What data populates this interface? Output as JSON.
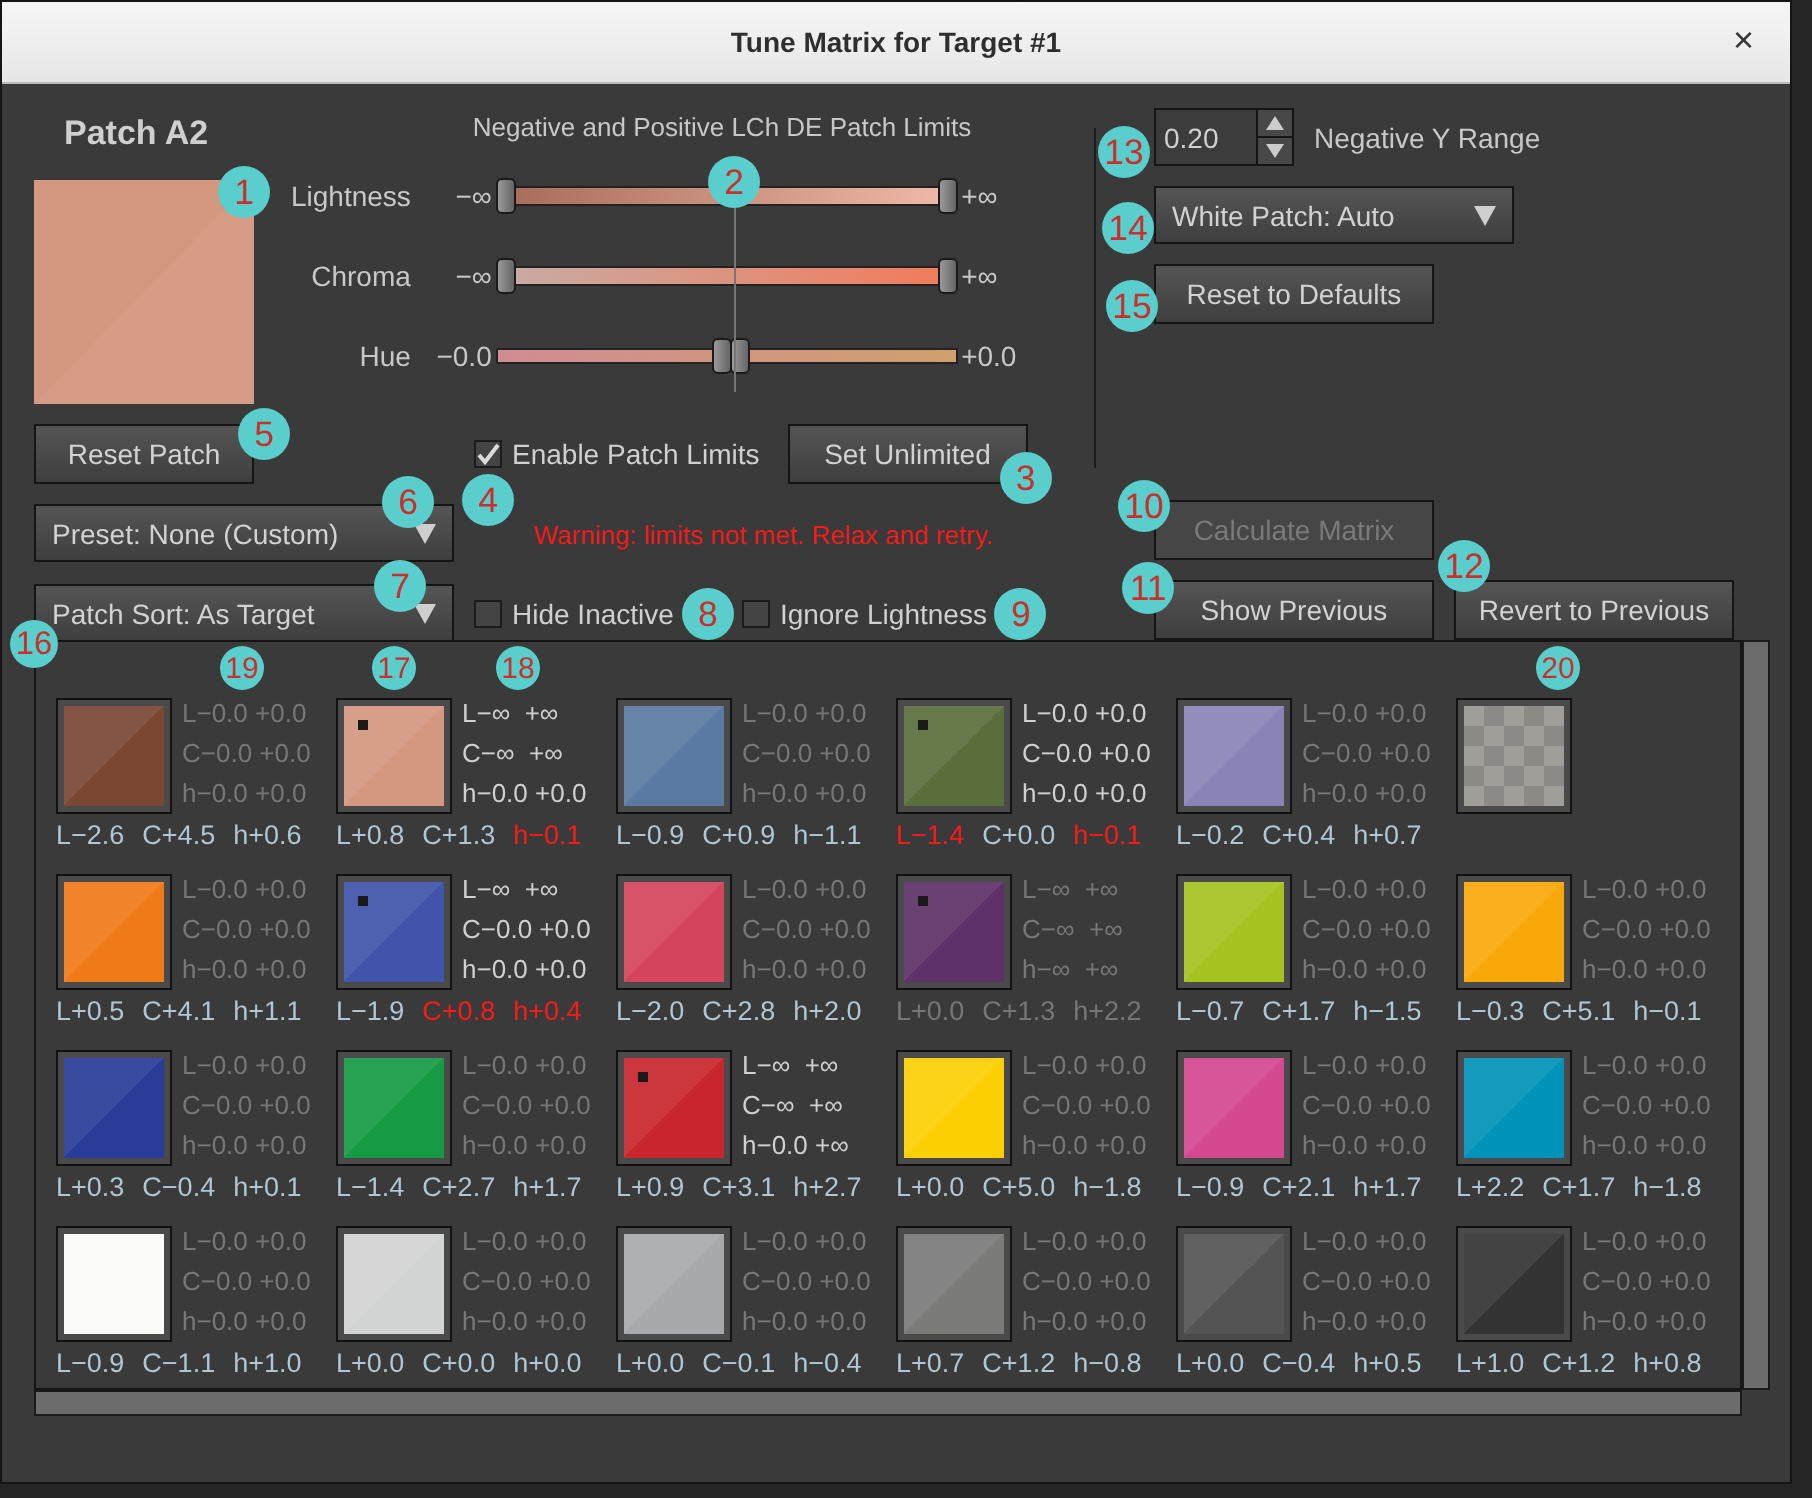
{
  "window": {
    "title": "Tune Matrix for Target #1",
    "close": "×"
  },
  "patch": {
    "title": "Patch A2",
    "color": "#d4977f",
    "callout": "1"
  },
  "limits_title": "Negative and Positive LCh DE Patch Limits",
  "sliders": {
    "callout": "2",
    "rows": [
      {
        "label": "Lightness",
        "kind": "lightness",
        "neg": "−∞",
        "pos": "+∞",
        "thumbs": [
          {
            "level": 0
          },
          {
            "level": 1
          }
        ]
      },
      {
        "label": "Chroma",
        "kind": "chroma",
        "neg": "−∞",
        "pos": "+∞",
        "thumbs": [
          {
            "level": 0
          },
          {
            "level": 1
          }
        ]
      },
      {
        "label": "Hue",
        "kind": "hue",
        "neg": "−0.0",
        "pos": "+0.0",
        "thumbs": [
          {
            "level": 0.49
          },
          {
            "level": 0.53
          }
        ]
      }
    ]
  },
  "reset_patch": {
    "label": "Reset Patch",
    "callout": "5"
  },
  "enable_limits": {
    "label": "Enable Patch Limits",
    "checked": true,
    "callout": "4"
  },
  "set_unlimited": {
    "label": "Set Unlimited",
    "callout": "3"
  },
  "preset": {
    "value": "Preset: None (Custom)",
    "callout": "6"
  },
  "warning": "Warning: limits not met. Relax and retry.",
  "patch_sort": {
    "value": "Patch Sort: As Target",
    "callout": "7"
  },
  "hide_inactive": {
    "label": "Hide Inactive",
    "checked": false,
    "callout": "8"
  },
  "ignore_lightness": {
    "label": "Ignore Lightness",
    "checked": false,
    "callout": "9"
  },
  "negative_y": {
    "value": "0.20",
    "label": "Negative Y Range",
    "callout": "13"
  },
  "white_patch": {
    "value": "White Patch: Auto",
    "callout": "14"
  },
  "reset_defaults": {
    "label": "Reset to Defaults",
    "callout": "15"
  },
  "calculate": {
    "label": "Calculate Matrix",
    "disabled": true,
    "callout": "10"
  },
  "show_previous": {
    "label": "Show Previous",
    "disabled": false,
    "callout": "11"
  },
  "revert": {
    "label": "Revert to Previous",
    "disabled": false,
    "callout": "12"
  },
  "patch_grid": {
    "callout": "16",
    "patches": [
      {
        "kind": "color",
        "color": "#7a4733",
        "marked": false,
        "limits_active": false,
        "inactive": false,
        "limits": [
          "L−0.0 +0.0",
          "C−0.0 +0.0",
          "h−0.0 +0.0"
        ],
        "values": [
          {
            "text": "L−2.6",
            "warn": false
          },
          {
            "text": "C+4.5",
            "warn": false
          },
          {
            "text": "h+0.6",
            "warn": false
          }
        ],
        "values_callout": "19"
      },
      {
        "kind": "color",
        "color": "#d4977f",
        "marked": true,
        "limits_active": true,
        "inactive": false,
        "limits": [
          "L−∞  +∞",
          "C−∞  +∞",
          "h−0.0 +0.0"
        ],
        "values": [
          {
            "text": "L+0.8",
            "warn": false
          },
          {
            "text": "C+1.3",
            "warn": false
          },
          {
            "text": "h−0.1",
            "warn": true
          }
        ],
        "swatch_callout": "17",
        "limits_callout": "18"
      },
      {
        "kind": "color",
        "color": "#5a79a3",
        "marked": false,
        "limits_active": false,
        "inactive": false,
        "limits": [
          "L−0.0 +0.0",
          "C−0.0 +0.0",
          "h−0.0 +0.0"
        ],
        "values": [
          {
            "text": "L−0.9",
            "warn": false
          },
          {
            "text": "C+0.9",
            "warn": false
          },
          {
            "text": "h−1.1",
            "warn": false
          }
        ]
      },
      {
        "kind": "color",
        "color": "#5a6e3c",
        "marked": true,
        "limits_active": true,
        "inactive": false,
        "limits": [
          "L−0.0 +0.0",
          "C−0.0 +0.0",
          "h−0.0 +0.0"
        ],
        "values": [
          {
            "text": "L−1.4",
            "warn": true
          },
          {
            "text": "C+0.0",
            "warn": false
          },
          {
            "text": "h−0.1",
            "warn": true
          }
        ]
      },
      {
        "kind": "color",
        "color": "#8a83b8",
        "marked": false,
        "limits_active": false,
        "inactive": false,
        "limits": [
          "L−0.0 +0.0",
          "C−0.0 +0.0",
          "h−0.0 +0.0"
        ],
        "values": [
          {
            "text": "L−0.2",
            "warn": false
          },
          {
            "text": "C+0.4",
            "warn": false
          },
          {
            "text": "h+0.7",
            "warn": false
          }
        ]
      },
      {
        "kind": "checker",
        "swatch_callout": "20"
      },
      {
        "kind": "color",
        "color": "#f07a18",
        "marked": false,
        "limits_active": false,
        "inactive": false,
        "limits": [
          "L−0.0 +0.0",
          "C−0.0 +0.0",
          "h−0.0 +0.0"
        ],
        "values": [
          {
            "text": "L+0.5",
            "warn": false
          },
          {
            "text": "C+4.1",
            "warn": false
          },
          {
            "text": "h+1.1",
            "warn": false
          }
        ]
      },
      {
        "kind": "color",
        "color": "#3f54aa",
        "marked": true,
        "limits_active": true,
        "inactive": false,
        "limits": [
          "L−∞  +∞",
          "C−0.0 +0.0",
          "h−0.0 +0.0"
        ],
        "values": [
          {
            "text": "L−1.9",
            "warn": false
          },
          {
            "text": "C+0.8",
            "warn": true
          },
          {
            "text": "h+0.4",
            "warn": true
          }
        ]
      },
      {
        "kind": "color",
        "color": "#d4445a",
        "marked": false,
        "limits_active": false,
        "inactive": false,
        "limits": [
          "L−0.0 +0.0",
          "C−0.0 +0.0",
          "h−0.0 +0.0"
        ],
        "values": [
          {
            "text": "L−2.0",
            "warn": false
          },
          {
            "text": "C+2.8",
            "warn": false
          },
          {
            "text": "h+2.0",
            "warn": false
          }
        ]
      },
      {
        "kind": "color",
        "color": "#5e3168",
        "marked": true,
        "limits_active": false,
        "inactive": true,
        "limits": [
          "L−∞  +∞",
          "C−∞  +∞",
          "h−∞  +∞"
        ],
        "values": [
          {
            "text": "L+0.0",
            "warn": false
          },
          {
            "text": "C+1.3",
            "warn": false
          },
          {
            "text": "h+2.2",
            "warn": false
          }
        ]
      },
      {
        "kind": "color",
        "color": "#a4c220",
        "marked": false,
        "limits_active": false,
        "inactive": false,
        "limits": [
          "L−0.0 +0.0",
          "C−0.0 +0.0",
          "h−0.0 +0.0"
        ],
        "values": [
          {
            "text": "L−0.7",
            "warn": false
          },
          {
            "text": "C+1.7",
            "warn": false
          },
          {
            "text": "h−1.5",
            "warn": false
          }
        ]
      },
      {
        "kind": "color",
        "color": "#f8a808",
        "marked": false,
        "limits_active": false,
        "inactive": false,
        "limits": [
          "L−0.0 +0.0",
          "C−0.0 +0.0",
          "h−0.0 +0.0"
        ],
        "values": [
          {
            "text": "L−0.3",
            "warn": false
          },
          {
            "text": "C+5.1",
            "warn": false
          },
          {
            "text": "h−0.1",
            "warn": false
          }
        ]
      },
      {
        "kind": "color",
        "color": "#283c98",
        "marked": false,
        "limits_active": false,
        "inactive": false,
        "limits": [
          "L−0.0 +0.0",
          "C−0.0 +0.0",
          "h−0.0 +0.0"
        ],
        "values": [
          {
            "text": "L+0.3",
            "warn": false
          },
          {
            "text": "C−0.4",
            "warn": false
          },
          {
            "text": "h+0.1",
            "warn": false
          }
        ]
      },
      {
        "kind": "color",
        "color": "#169a44",
        "marked": false,
        "limits_active": false,
        "inactive": false,
        "limits": [
          "L−0.0 +0.0",
          "C−0.0 +0.0",
          "h−0.0 +0.0"
        ],
        "values": [
          {
            "text": "L−1.4",
            "warn": false
          },
          {
            "text": "C+2.7",
            "warn": false
          },
          {
            "text": "h+1.7",
            "warn": false
          }
        ]
      },
      {
        "kind": "color",
        "color": "#c8262c",
        "marked": true,
        "limits_active": true,
        "inactive": false,
        "limits": [
          "L−∞  +∞",
          "C−∞  +∞",
          "h−0.0 +∞"
        ],
        "values": [
          {
            "text": "L+0.9",
            "warn": false
          },
          {
            "text": "C+3.1",
            "warn": false
          },
          {
            "text": "h+2.7",
            "warn": false
          }
        ]
      },
      {
        "kind": "color",
        "color": "#fccf02",
        "marked": false,
        "limits_active": false,
        "inactive": false,
        "limits": [
          "L−0.0 +0.0",
          "C−0.0 +0.0",
          "h−0.0 +0.0"
        ],
        "values": [
          {
            "text": "L+0.0",
            "warn": false
          },
          {
            "text": "C+5.0",
            "warn": false
          },
          {
            "text": "h−1.8",
            "warn": false
          }
        ]
      },
      {
        "kind": "color",
        "color": "#d44892",
        "marked": false,
        "limits_active": false,
        "inactive": false,
        "limits": [
          "L−0.0 +0.0",
          "C−0.0 +0.0",
          "h−0.0 +0.0"
        ],
        "values": [
          {
            "text": "L−0.9",
            "warn": false
          },
          {
            "text": "C+2.1",
            "warn": false
          },
          {
            "text": "h+1.7",
            "warn": false
          }
        ]
      },
      {
        "kind": "color",
        "color": "#0092b8",
        "marked": false,
        "limits_active": false,
        "inactive": false,
        "limits": [
          "L−0.0 +0.0",
          "C−0.0 +0.0",
          "h−0.0 +0.0"
        ],
        "values": [
          {
            "text": "L+2.2",
            "warn": false
          },
          {
            "text": "C+1.7",
            "warn": false
          },
          {
            "text": "h−1.8",
            "warn": false
          }
        ]
      },
      {
        "kind": "color",
        "color": "#fafaf8",
        "marked": false,
        "limits_active": false,
        "inactive": false,
        "limits": [
          "L−0.0 +0.0",
          "C−0.0 +0.0",
          "h−0.0 +0.0"
        ],
        "values": [
          {
            "text": "L−0.9",
            "warn": false
          },
          {
            "text": "C−1.1",
            "warn": false
          },
          {
            "text": "h+1.0",
            "warn": false
          }
        ]
      },
      {
        "kind": "color",
        "color": "#d2d3d3",
        "marked": false,
        "limits_active": false,
        "inactive": false,
        "limits": [
          "L−0.0 +0.0",
          "C−0.0 +0.0",
          "h−0.0 +0.0"
        ],
        "values": [
          {
            "text": "L+0.0",
            "warn": false
          },
          {
            "text": "C+0.0",
            "warn": false
          },
          {
            "text": "h+0.0",
            "warn": false
          }
        ]
      },
      {
        "kind": "color",
        "color": "#a7a8a9",
        "marked": false,
        "limits_active": false,
        "inactive": false,
        "limits": [
          "L−0.0 +0.0",
          "C−0.0 +0.0",
          "h−0.0 +0.0"
        ],
        "values": [
          {
            "text": "L+0.0",
            "warn": false
          },
          {
            "text": "C−0.1",
            "warn": false
          },
          {
            "text": "h−0.4",
            "warn": false
          }
        ]
      },
      {
        "kind": "color",
        "color": "#7a7a79",
        "marked": false,
        "limits_active": false,
        "inactive": false,
        "limits": [
          "L−0.0 +0.0",
          "C−0.0 +0.0",
          "h−0.0 +0.0"
        ],
        "values": [
          {
            "text": "L+0.7",
            "warn": false
          },
          {
            "text": "C+1.2",
            "warn": false
          },
          {
            "text": "h−0.8",
            "warn": false
          }
        ]
      },
      {
        "kind": "color",
        "color": "#545454",
        "marked": false,
        "limits_active": false,
        "inactive": false,
        "limits": [
          "L−0.0 +0.0",
          "C−0.0 +0.0",
          "h−0.0 +0.0"
        ],
        "values": [
          {
            "text": "L+0.0",
            "warn": false
          },
          {
            "text": "C−0.4",
            "warn": false
          },
          {
            "text": "h+0.5",
            "warn": false
          }
        ]
      },
      {
        "kind": "color",
        "color": "#333333",
        "marked": false,
        "limits_active": false,
        "inactive": false,
        "limits": [
          "L−0.0 +0.0",
          "C−0.0 +0.0",
          "h−0.0 +0.0"
        ],
        "values": [
          {
            "text": "L+1.0",
            "warn": false
          },
          {
            "text": "C+1.2",
            "warn": false
          },
          {
            "text": "h+0.8",
            "warn": false
          }
        ]
      }
    ]
  }
}
